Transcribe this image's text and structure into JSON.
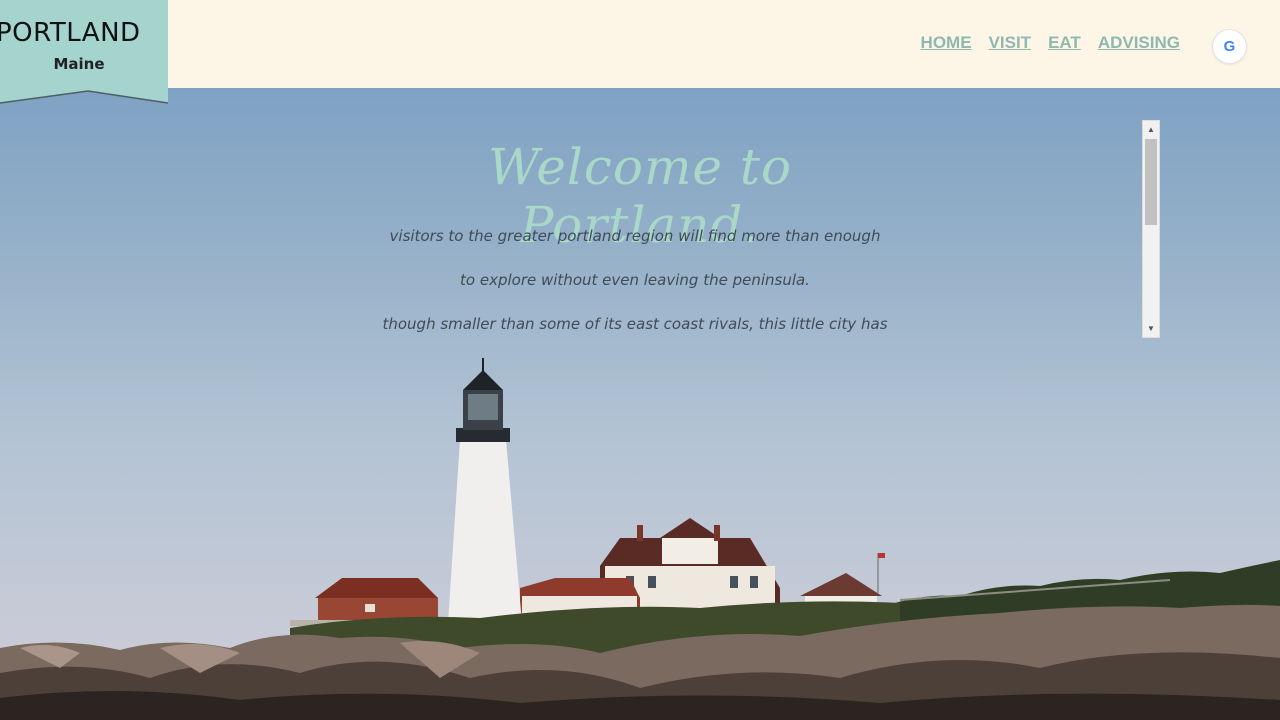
{
  "logo": {
    "title": "PORTLAND",
    "subtitle": "Maine",
    "background": "#a5d3cd"
  },
  "nav": {
    "items": [
      {
        "label": "HOME"
      },
      {
        "label": "VISIT"
      },
      {
        "label": "EAT"
      },
      {
        "label": "ADVISING"
      }
    ],
    "color": "#8fb8b0"
  },
  "google_button": {
    "glyph": "G",
    "icon": "google-icon"
  },
  "hero": {
    "heading": "Welcome to Portland.",
    "lines": [
      "visitors to the greater portland region will find more than enough",
      "to explore without even leaving the peninsula.",
      "though smaller than some of its east coast rivals, this little city has"
    ],
    "heading_color": "#a9d8c9",
    "text_color": "#3f4b57"
  },
  "scrollbar": {
    "up_icon": "▲",
    "down_icon": "▼"
  },
  "colors": {
    "header_bg": "#fdf6e6",
    "sky_top": "#7fa2c4",
    "sky_bottom": "#cfcdd6"
  }
}
